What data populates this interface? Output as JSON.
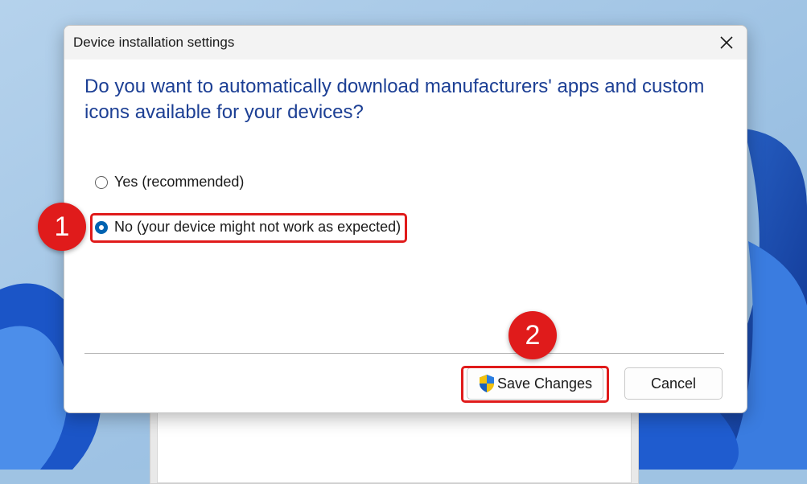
{
  "dialog": {
    "title": "Device installation settings",
    "question": "Do you want to automatically download manufacturers' apps and custom icons available for your devices?",
    "options": [
      {
        "label": "Yes (recommended)",
        "selected": false
      },
      {
        "label": "No (your device might not work as expected)",
        "selected": true
      }
    ],
    "buttons": {
      "save_label": "Save Changes",
      "cancel_label": "Cancel"
    }
  },
  "annotations": {
    "callout_1": "1",
    "callout_2": "2"
  },
  "icons": {
    "close": "close-icon",
    "shield": "uac-shield-icon"
  },
  "colors": {
    "question_text": "#1c3f94",
    "radio_selected": "#0063b1",
    "annotation": "#e01b1b"
  }
}
